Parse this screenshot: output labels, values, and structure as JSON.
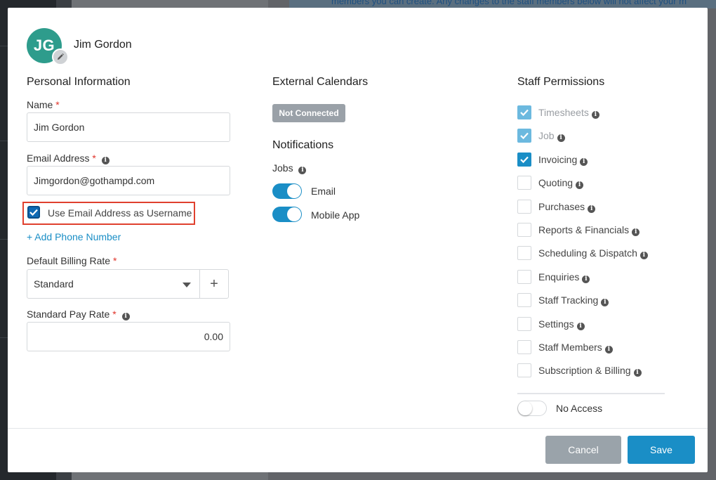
{
  "background": {
    "notice_text": "members you can create. Any changes to the staff members below will not affect your m"
  },
  "profile": {
    "initials": "JG",
    "name": "Jim Gordon"
  },
  "personal": {
    "title": "Personal Information",
    "name_label": "Name",
    "name_value": "Jim Gordon",
    "email_label": "Email Address",
    "email_value": "Jimgordon@gothampd.com",
    "use_email_label": "Use Email Address as Username",
    "add_phone": "+ Add Phone Number",
    "billing_label": "Default Billing Rate",
    "billing_value": "Standard",
    "pay_label": "Standard Pay Rate",
    "pay_value": "0.00",
    "required_mark": "*"
  },
  "calendars": {
    "title": "External Calendars",
    "status": "Not Connected"
  },
  "notifications": {
    "title": "Notifications",
    "jobs_label": "Jobs",
    "email_label": "Email",
    "mobile_label": "Mobile App"
  },
  "permissions": {
    "title": "Staff Permissions",
    "items": [
      {
        "label": "Timesheets",
        "state": "checked-disabled"
      },
      {
        "label": "Job",
        "state": "checked-disabled"
      },
      {
        "label": "Invoicing",
        "state": "checked"
      },
      {
        "label": "Quoting",
        "state": "unchecked"
      },
      {
        "label": "Purchases",
        "state": "unchecked"
      },
      {
        "label": "Reports & Financials",
        "state": "unchecked"
      },
      {
        "label": "Scheduling & Dispatch",
        "state": "unchecked"
      },
      {
        "label": "Enquiries",
        "state": "unchecked"
      },
      {
        "label": "Staff Tracking",
        "state": "unchecked"
      },
      {
        "label": "Settings",
        "state": "unchecked"
      },
      {
        "label": "Staff Members",
        "state": "unchecked"
      },
      {
        "label": "Subscription & Billing",
        "state": "unchecked"
      }
    ],
    "no_access_label": "No Access"
  },
  "footer": {
    "cancel": "Cancel",
    "save": "Save"
  },
  "colors": {
    "accent": "#1a8ec6",
    "avatar": "#2e9c8c",
    "required": "#e0342b",
    "highlight": "#e0402e"
  }
}
